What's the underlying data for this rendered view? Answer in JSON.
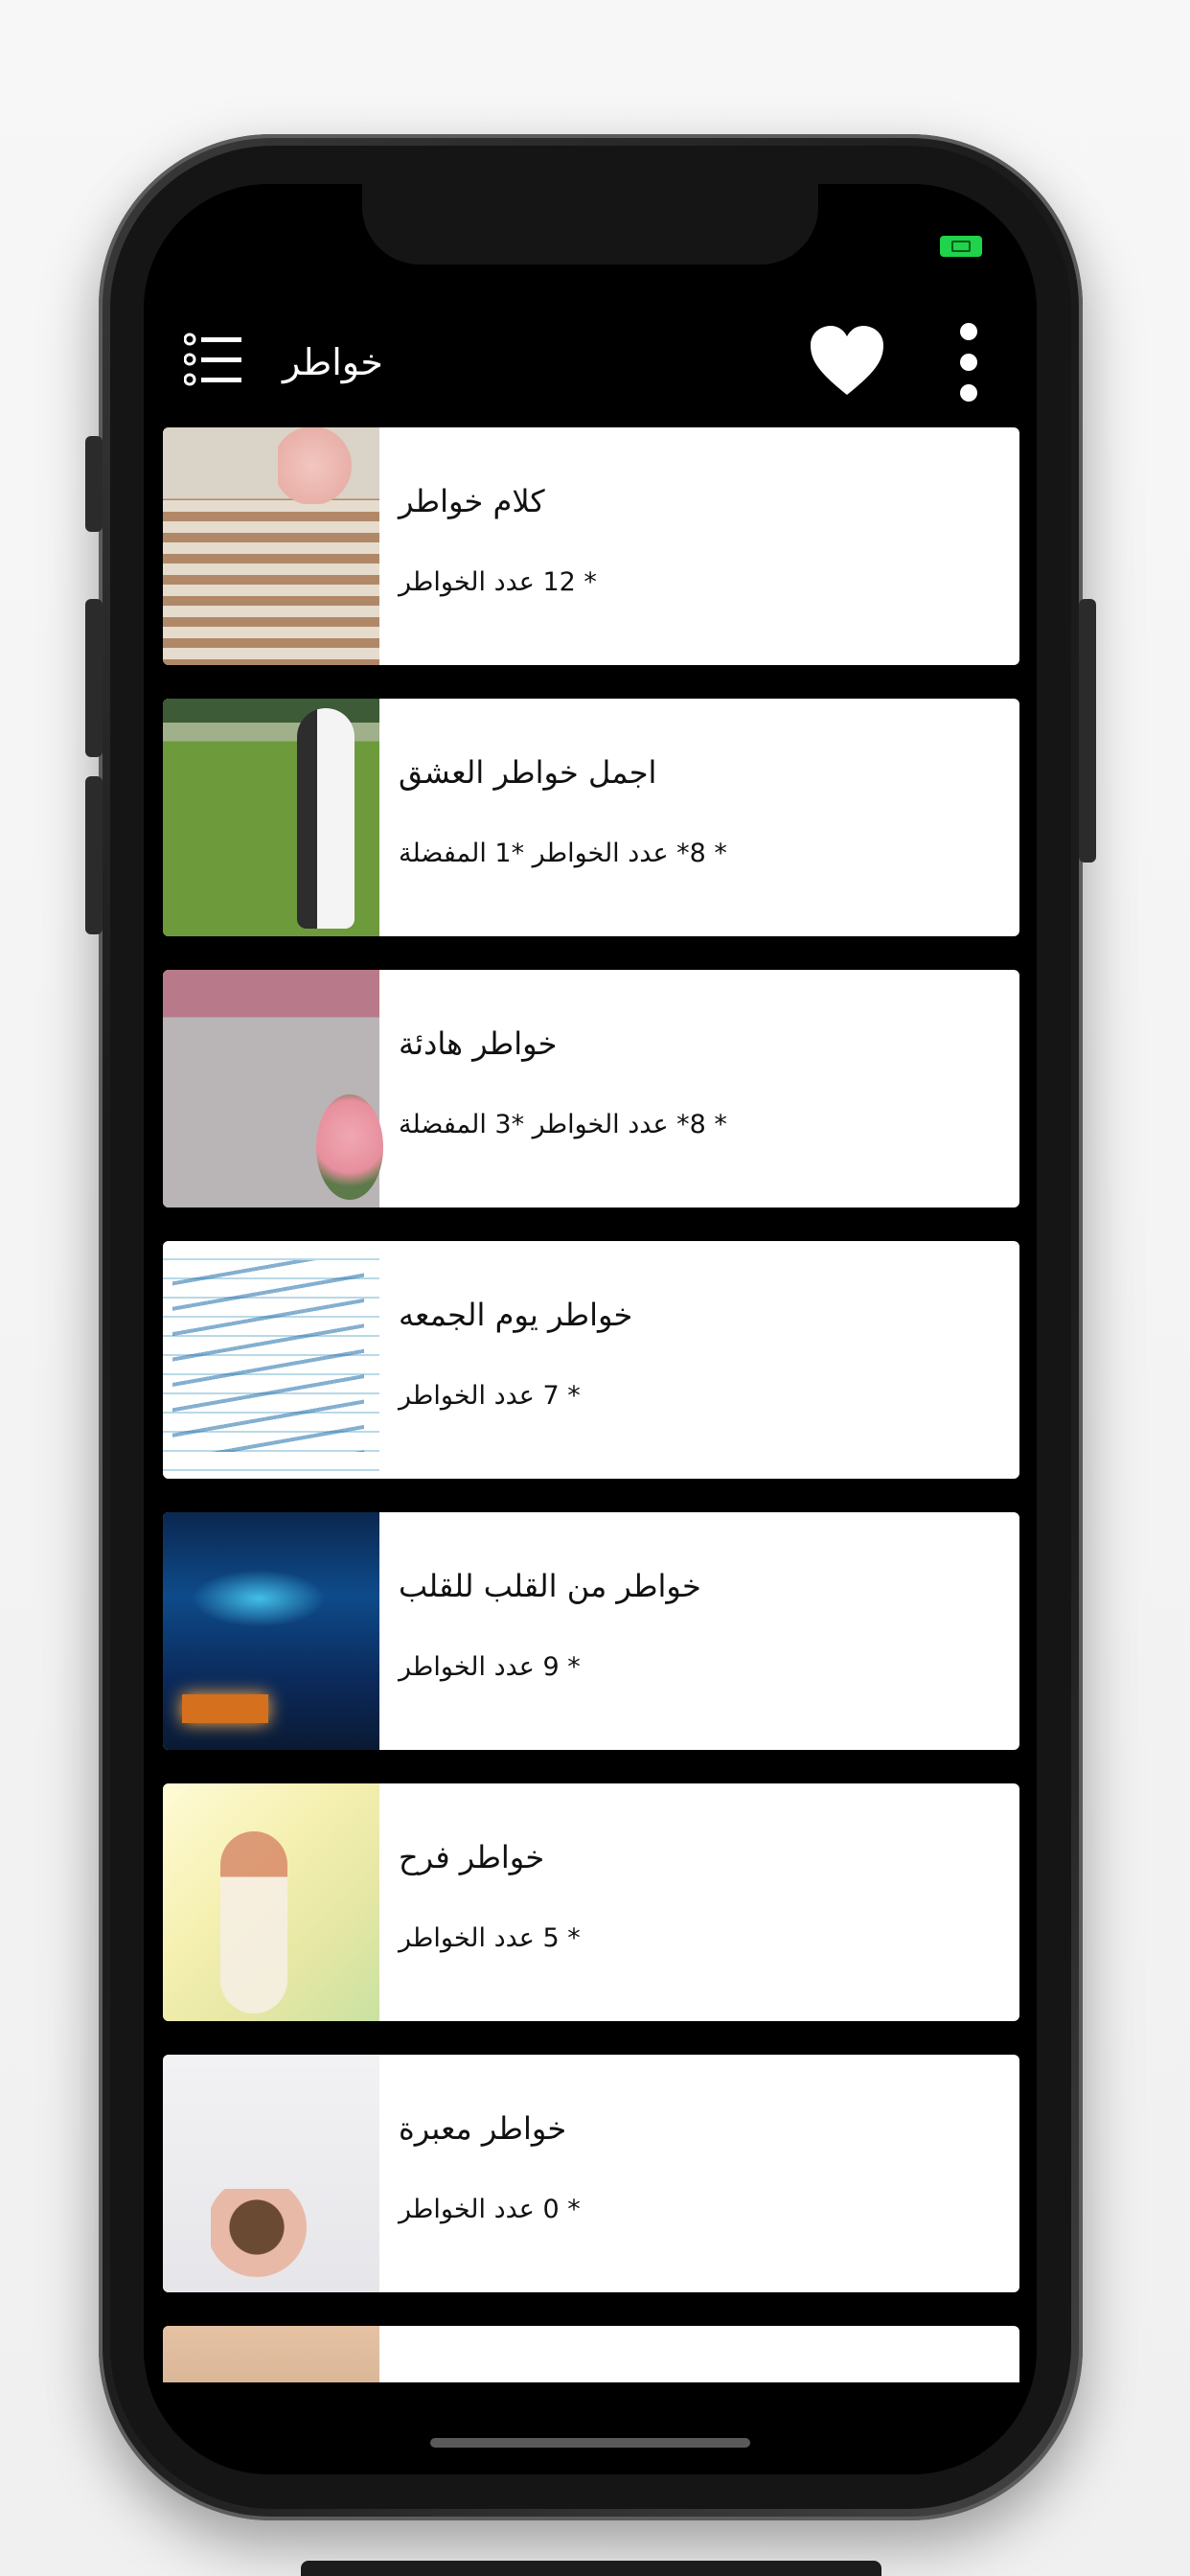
{
  "app_bar": {
    "title": "خواطر",
    "icons": [
      "list-menu-icon",
      "heart-icon",
      "more-vert-icon"
    ]
  },
  "status_bar": {
    "battery_color": "#1fd34a"
  },
  "categories": [
    {
      "title": "كلام خواطر",
      "meta": "* 12 عدد الخواطر",
      "thumb": "books"
    },
    {
      "title": "اجمل خواطر العشق",
      "meta": "* 8* عدد الخواطر *1 المفضلة",
      "thumb": "wedding"
    },
    {
      "title": "خواطر هادئة",
      "meta": "* 8* عدد الخواطر *3 المفضلة",
      "thumb": "rain"
    },
    {
      "title": "خواطر يوم الجمعه",
      "meta": "* 7 عدد الخواطر",
      "thumb": "notebook"
    },
    {
      "title": "خواطر من القلب للقلب",
      "meta": "* 9 عدد الخواطر",
      "thumb": "aurora"
    },
    {
      "title": "خواطر فرح",
      "meta": "* 5 عدد الخواطر",
      "thumb": "joy"
    },
    {
      "title": "خواطر معبرة",
      "meta": "* 0 عدد الخواطر",
      "thumb": "reading"
    }
  ],
  "colors": {
    "background": "#000000",
    "card": "#ffffff",
    "text": "#111111"
  }
}
